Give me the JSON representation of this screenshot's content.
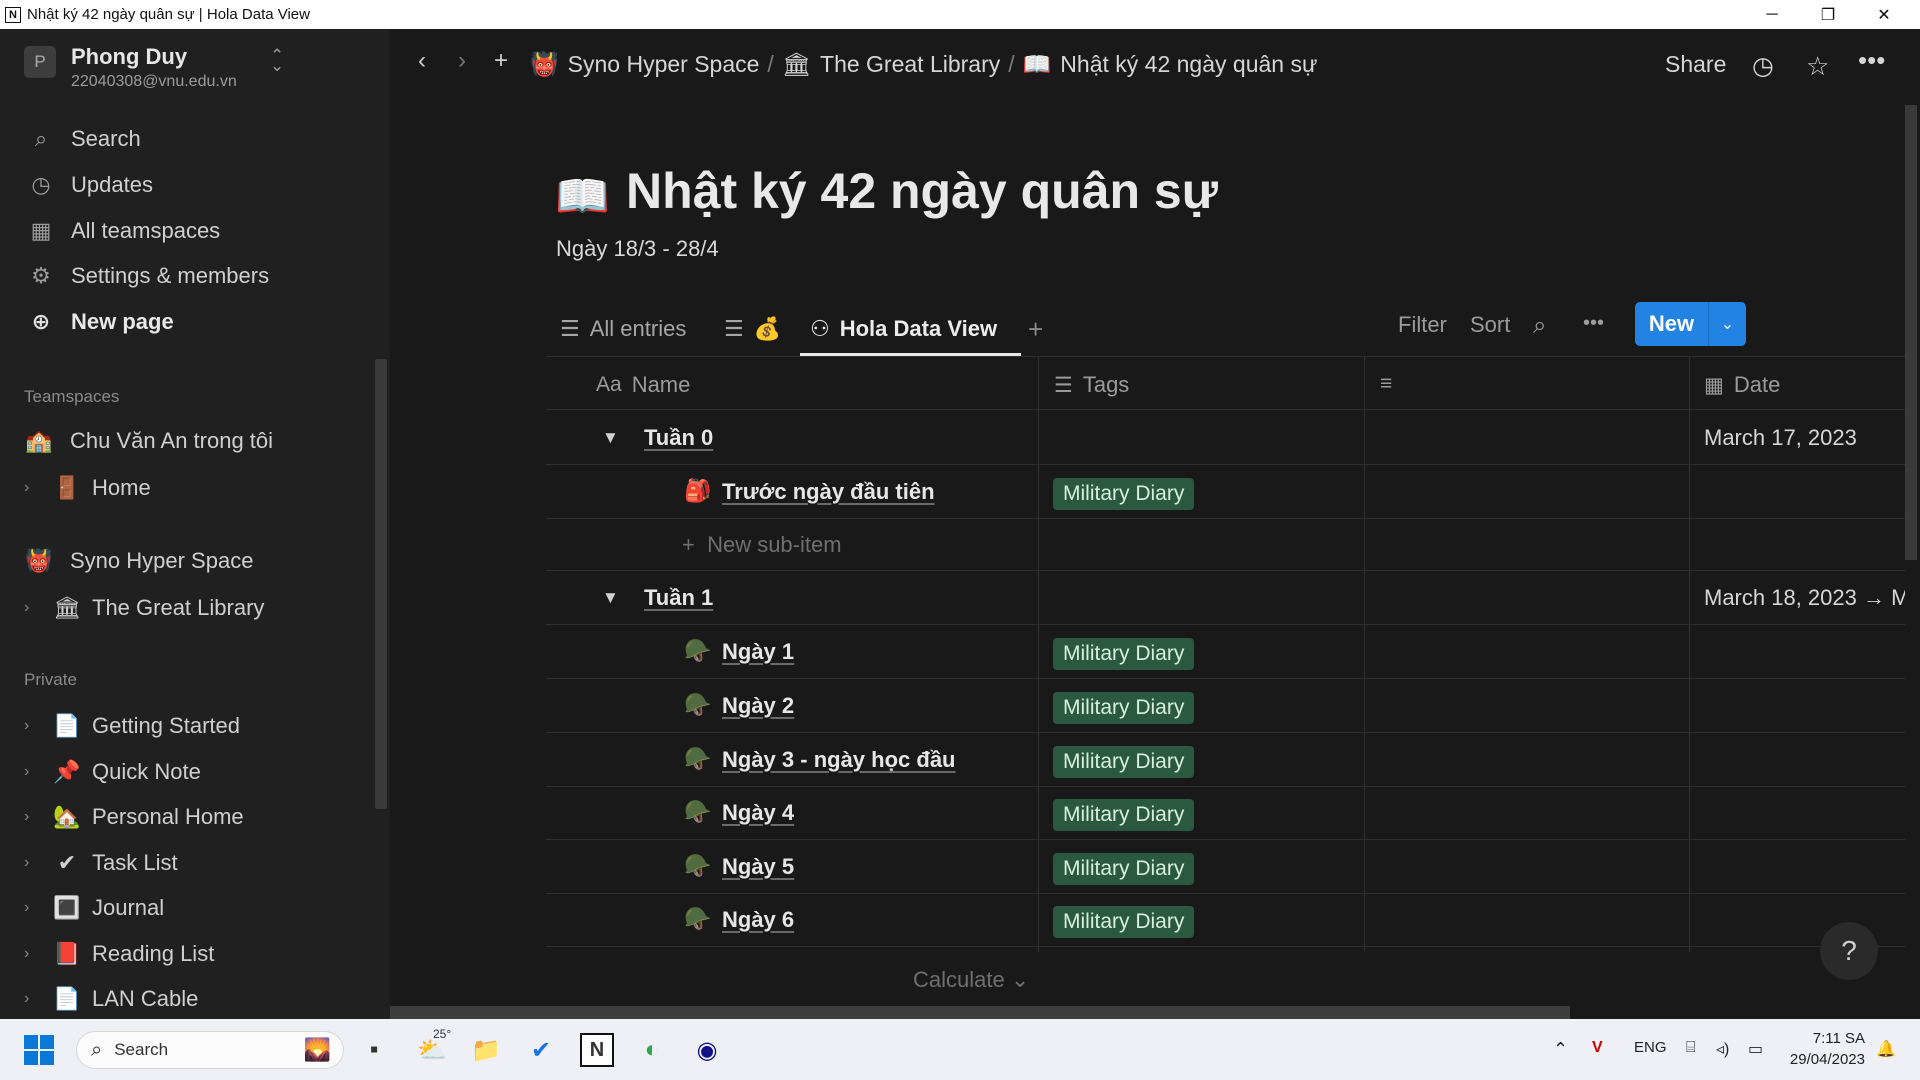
{
  "window": {
    "title": "Nhật ký 42 ngày quân sự | Hola Data View"
  },
  "sidebar": {
    "workspace": {
      "avatar": "P",
      "name": "Phong Duy",
      "email": "22040308@vnu.edu.vn"
    },
    "nav": [
      {
        "icon": "search-icon",
        "label": "Search"
      },
      {
        "icon": "clock-icon",
        "label": "Updates"
      },
      {
        "icon": "building-icon",
        "label": "All teamspaces"
      },
      {
        "icon": "gear-icon",
        "label": "Settings & members"
      },
      {
        "icon": "plus-circle-icon",
        "label": "New page"
      }
    ],
    "teamspaces_label": "Teamspaces",
    "teamspaces": [
      {
        "label": "Chu Văn An trong tôi",
        "emoji": "🏫"
      },
      {
        "label": "Home",
        "emoji": "🚪",
        "child": true
      },
      {
        "label": "Syno Hyper Space",
        "emoji": "👹"
      },
      {
        "label": "The Great Library",
        "emoji": "🏛",
        "child": true
      }
    ],
    "private_label": "Private",
    "private": [
      {
        "label": "Getting Started",
        "emoji": "📄"
      },
      {
        "label": "Quick Note",
        "emoji": "📌"
      },
      {
        "label": "Personal Home",
        "emoji": "🏡"
      },
      {
        "label": "Task List",
        "emoji": "✔"
      },
      {
        "label": "Journal",
        "emoji": "🔳"
      },
      {
        "label": "Reading List",
        "emoji": "📕"
      },
      {
        "label": "LAN Cable",
        "emoji": "📄"
      }
    ]
  },
  "topbar": {
    "breadcrumbs": [
      {
        "emoji": "👹",
        "label": "Syno Hyper Space"
      },
      {
        "emoji": "🏛",
        "label": "The Great Library"
      },
      {
        "emoji": "📖",
        "label": "Nhật ký 42 ngày quân sự"
      }
    ],
    "share_label": "Share"
  },
  "page": {
    "title": "Nhật ký 42 ngày quân sự",
    "subtitle": "Ngày 18/3 - 28/4"
  },
  "views": {
    "tabs": [
      {
        "label": "All entries",
        "icon": "list-icon"
      },
      {
        "label": "",
        "icon": "list-icon",
        "emoji": "💰"
      },
      {
        "label": "Hola Data View",
        "icon": "hierarchy-icon",
        "active": true
      }
    ],
    "filter_label": "Filter",
    "sort_label": "Sort",
    "new_label": "New"
  },
  "table": {
    "columns": [
      {
        "icon": "Aa",
        "label": "Name"
      },
      {
        "icon": "list-icon",
        "label": "Tags"
      },
      {
        "icon": "text-icon",
        "label": ""
      },
      {
        "icon": "calendar-icon",
        "label": "Date"
      }
    ],
    "groups": [
      {
        "name": "Tuần 0",
        "date": "March 17, 2023",
        "rows": [
          {
            "emoji": "🎒",
            "name": "Trước ngày đầu tiên",
            "tag": "Military Diary"
          }
        ],
        "new_sub_item": "New sub-item"
      },
      {
        "name": "Tuần 1",
        "date": "March 18, 2023 → M",
        "rows": [
          {
            "emoji": "🪖",
            "name": "Ngày 1",
            "tag": "Military Diary"
          },
          {
            "emoji": "🪖",
            "name": "Ngày 2",
            "tag": "Military Diary"
          },
          {
            "emoji": "🪖",
            "name": "Ngày 3 - ngày học đầu",
            "tag": "Military Diary"
          },
          {
            "emoji": "🪖",
            "name": "Ngày 4",
            "tag": "Military Diary"
          },
          {
            "emoji": "🪖",
            "name": "Ngày 5",
            "tag": "Military Diary"
          },
          {
            "emoji": "🪖",
            "name": "Ngày 6",
            "tag": "Military Diary"
          }
        ]
      }
    ],
    "calculate_label": "Calculate"
  },
  "help_label": "?",
  "taskbar": {
    "search_label": "Search",
    "weather_temp": "25°",
    "language": "ENG",
    "time": "7:11 SA",
    "date": "29/04/2023"
  }
}
